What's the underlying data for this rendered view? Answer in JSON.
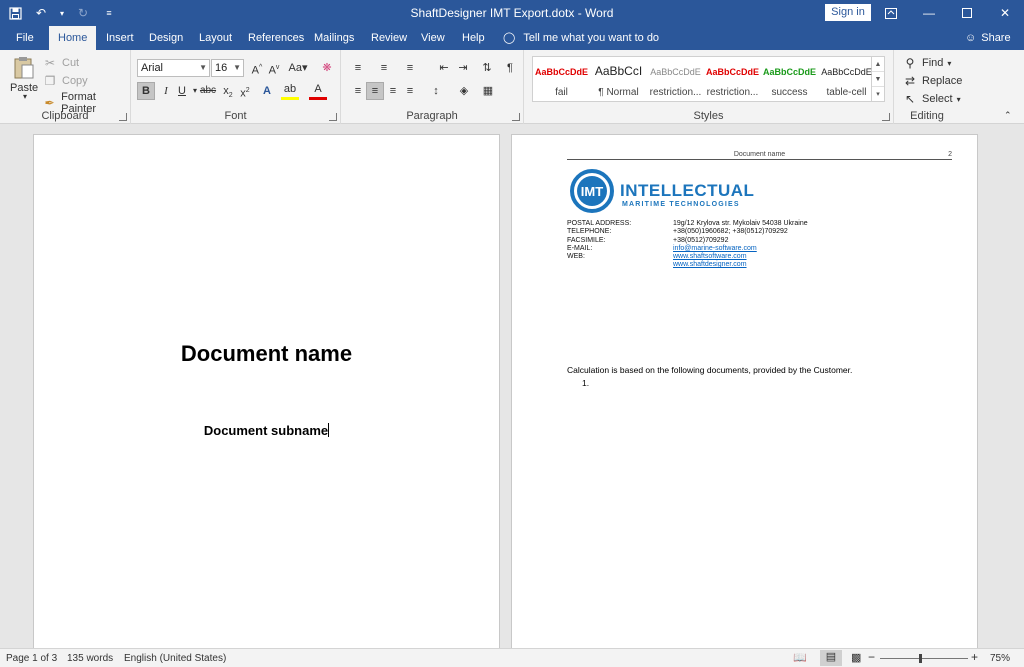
{
  "window": {
    "title": "ShaftDesigner IMT Export.dotx  -  Word",
    "signin_label": "Sign in"
  },
  "tabs": [
    "File",
    "Home",
    "Insert",
    "Design",
    "Layout",
    "References",
    "Mailings",
    "Review",
    "View",
    "Help"
  ],
  "tell_me": "Tell me what you want to do",
  "share_label": "Share",
  "clipboard": {
    "paste": "Paste",
    "cut": "Cut",
    "copy": "Copy",
    "format_painter": "Format Painter",
    "label": "Clipboard"
  },
  "font": {
    "name": "Arial",
    "size": "16",
    "label": "Font"
  },
  "paragraph": {
    "label": "Paragraph"
  },
  "styles": {
    "label": "Styles",
    "items": [
      {
        "preview": "AaBbCcDdE",
        "name": "fail",
        "color": "#e00000"
      },
      {
        "preview": "AaBbCcI",
        "name": "¶ Normal",
        "color": "#222222"
      },
      {
        "preview": "AaBbCcDdE",
        "name": "restriction...",
        "color": "#888888"
      },
      {
        "preview": "AaBbCcDdE",
        "name": "restriction...",
        "color": "#e00000"
      },
      {
        "preview": "AaBbCcDdE",
        "name": "success",
        "color": "#1a9a1a"
      },
      {
        "preview": "AaBbCcDdE",
        "name": "table-cell",
        "color": "#222222"
      }
    ]
  },
  "editing": {
    "find": "Find",
    "replace": "Replace",
    "select": "Select",
    "label": "Editing"
  },
  "page1": {
    "title": "Document name",
    "subtitle": "Document subname"
  },
  "page2": {
    "header_name": "Document name",
    "header_page": "2",
    "logo_main": "INTELLECTUAL",
    "logo_sub": "MARITIME TECHNOLOGIES",
    "logo_mark": "IMT",
    "contacts": [
      {
        "key": "POSTAL ADDRESS:",
        "value": "19g/12 Krylova str. Mykolaiv 54038 Ukraine",
        "link": false
      },
      {
        "key": "TELEPHONE:",
        "value": "+38(050)1960682; +38(0512)709292",
        "link": false
      },
      {
        "key": "FACSIMILE:",
        "value": "+38(0512)709292",
        "link": false
      },
      {
        "key": "E-MAIL:",
        "value": "info@marine-software.com",
        "link": true
      },
      {
        "key": "WEB:",
        "value": "www.shaftsoftware.com",
        "link": true
      },
      {
        "key": "",
        "value": "www.shaftdesigner.com",
        "link": true
      }
    ],
    "calc_text": "Calculation is based on the following documents, provided by the Customer.",
    "list_number": "1."
  },
  "status": {
    "page": "Page 1 of 3",
    "words": "135 words",
    "language": "English (United States)",
    "zoom": "75%"
  },
  "colors": {
    "accent": "#2b579a",
    "logo_blue": "#1c75bc"
  }
}
